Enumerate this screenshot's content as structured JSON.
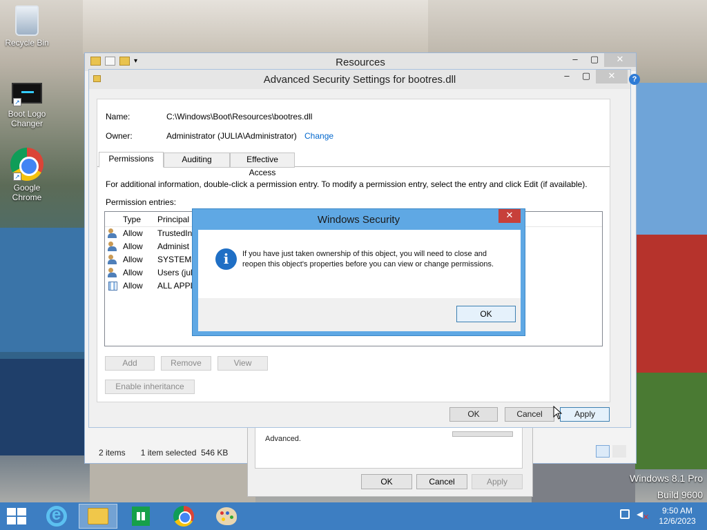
{
  "desktop": {
    "icons": [
      {
        "label": "Recycle Bin"
      },
      {
        "label": "Boot Logo Changer"
      },
      {
        "label": "Google Chrome"
      }
    ],
    "watermark": {
      "line1": "Windows 8.1 Pro",
      "line2": "Build 9600"
    }
  },
  "explorer": {
    "title": "Resources",
    "status_items": "2 items",
    "status_selected": "1 item selected  546 KB"
  },
  "properties": {
    "advanced_text": "Advanced.",
    "ok": "OK",
    "cancel": "Cancel",
    "apply": "Apply"
  },
  "advanced": {
    "title": "Advanced Security Settings for bootres.dll",
    "name_label": "Name:",
    "name_value": "C:\\Windows\\Boot\\Resources\\bootres.dll",
    "owner_label": "Owner:",
    "owner_value": "Administrator (JULIA\\Administrator)",
    "change_link": "Change",
    "tabs": [
      {
        "label": "Permissions",
        "active": true
      },
      {
        "label": "Auditing",
        "active": false
      },
      {
        "label": "Effective Access",
        "active": false
      }
    ],
    "info_text": "For additional information, double-click a permission entry. To modify a permission entry, select the entry and click Edit (if available).",
    "entries_label": "Permission entries:",
    "columns": {
      "type": "Type",
      "principal": "Principal"
    },
    "entries": [
      {
        "type": "Allow",
        "principal": "TrustedIn",
        "icon": "users-icon"
      },
      {
        "type": "Allow",
        "principal": "Administ",
        "icon": "users-icon"
      },
      {
        "type": "Allow",
        "principal": "SYSTEM",
        "icon": "users-icon"
      },
      {
        "type": "Allow",
        "principal": "Users (juli",
        "icon": "users-icon"
      },
      {
        "type": "Allow",
        "principal": "ALL APPL",
        "icon": "app-package-icon"
      }
    ],
    "buttons": {
      "add": "Add",
      "remove": "Remove",
      "view": "View",
      "enable_inheritance": "Enable inheritance",
      "ok": "OK",
      "cancel": "Cancel",
      "apply": "Apply"
    }
  },
  "security_dialog": {
    "title": "Windows Security",
    "message": "If you have just taken ownership of this object, you will need to close and reopen this object's properties before you can view or change permissions.",
    "ok": "OK",
    "accent": "#5fa8e4"
  },
  "taskbar": {
    "time": "9:50 AM",
    "date": "12/6/2023",
    "color": "#3d7ec2"
  }
}
